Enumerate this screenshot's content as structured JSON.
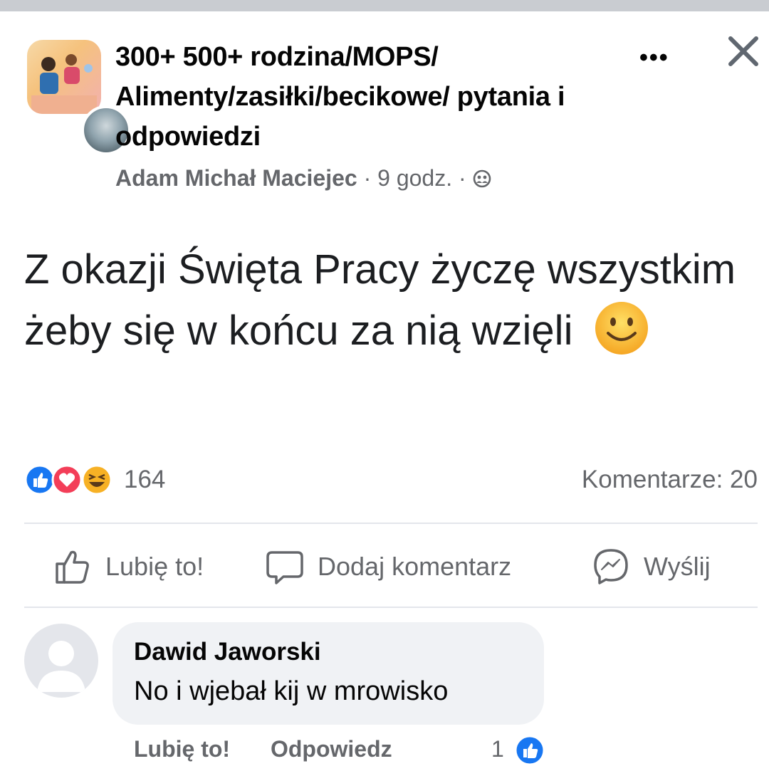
{
  "post": {
    "group_name": "300+ 500+ rodzina/MOPS/ Alimenty/zasiłki/becikowe/ pytania i odpowiedzi",
    "author": "Adam Michał Maciejec",
    "time": "9 godz.",
    "separator": "·",
    "text": "Z okazji Święta Pracy życzę wszystkim żeby się w końcu za nią wzięli",
    "reaction_count": "164",
    "comment_count": "Komentarze: 20"
  },
  "actions": {
    "like": "Lubię to!",
    "comment": "Dodaj komentarz",
    "send": "Wyślij"
  },
  "comment": {
    "author": "Dawid Jaworski",
    "text": "No i wjebał kij w mrowisko",
    "like_label": "Lubię to!",
    "reply_label": "Odpowiedz",
    "reactions": "1"
  },
  "colors": {
    "like_blue": "#1877f2",
    "love_red": "#f33e58",
    "haha_yellow": "#f7b125",
    "secondary_text": "#65676b",
    "bubble_bg": "#f0f2f5"
  },
  "icons": {
    "more": "more-dots-icon",
    "close": "close-icon",
    "audience": "friends-audience-icon",
    "like": "thumbs-up-outline-icon",
    "comment": "speech-bubble-icon",
    "send": "messenger-icon"
  }
}
